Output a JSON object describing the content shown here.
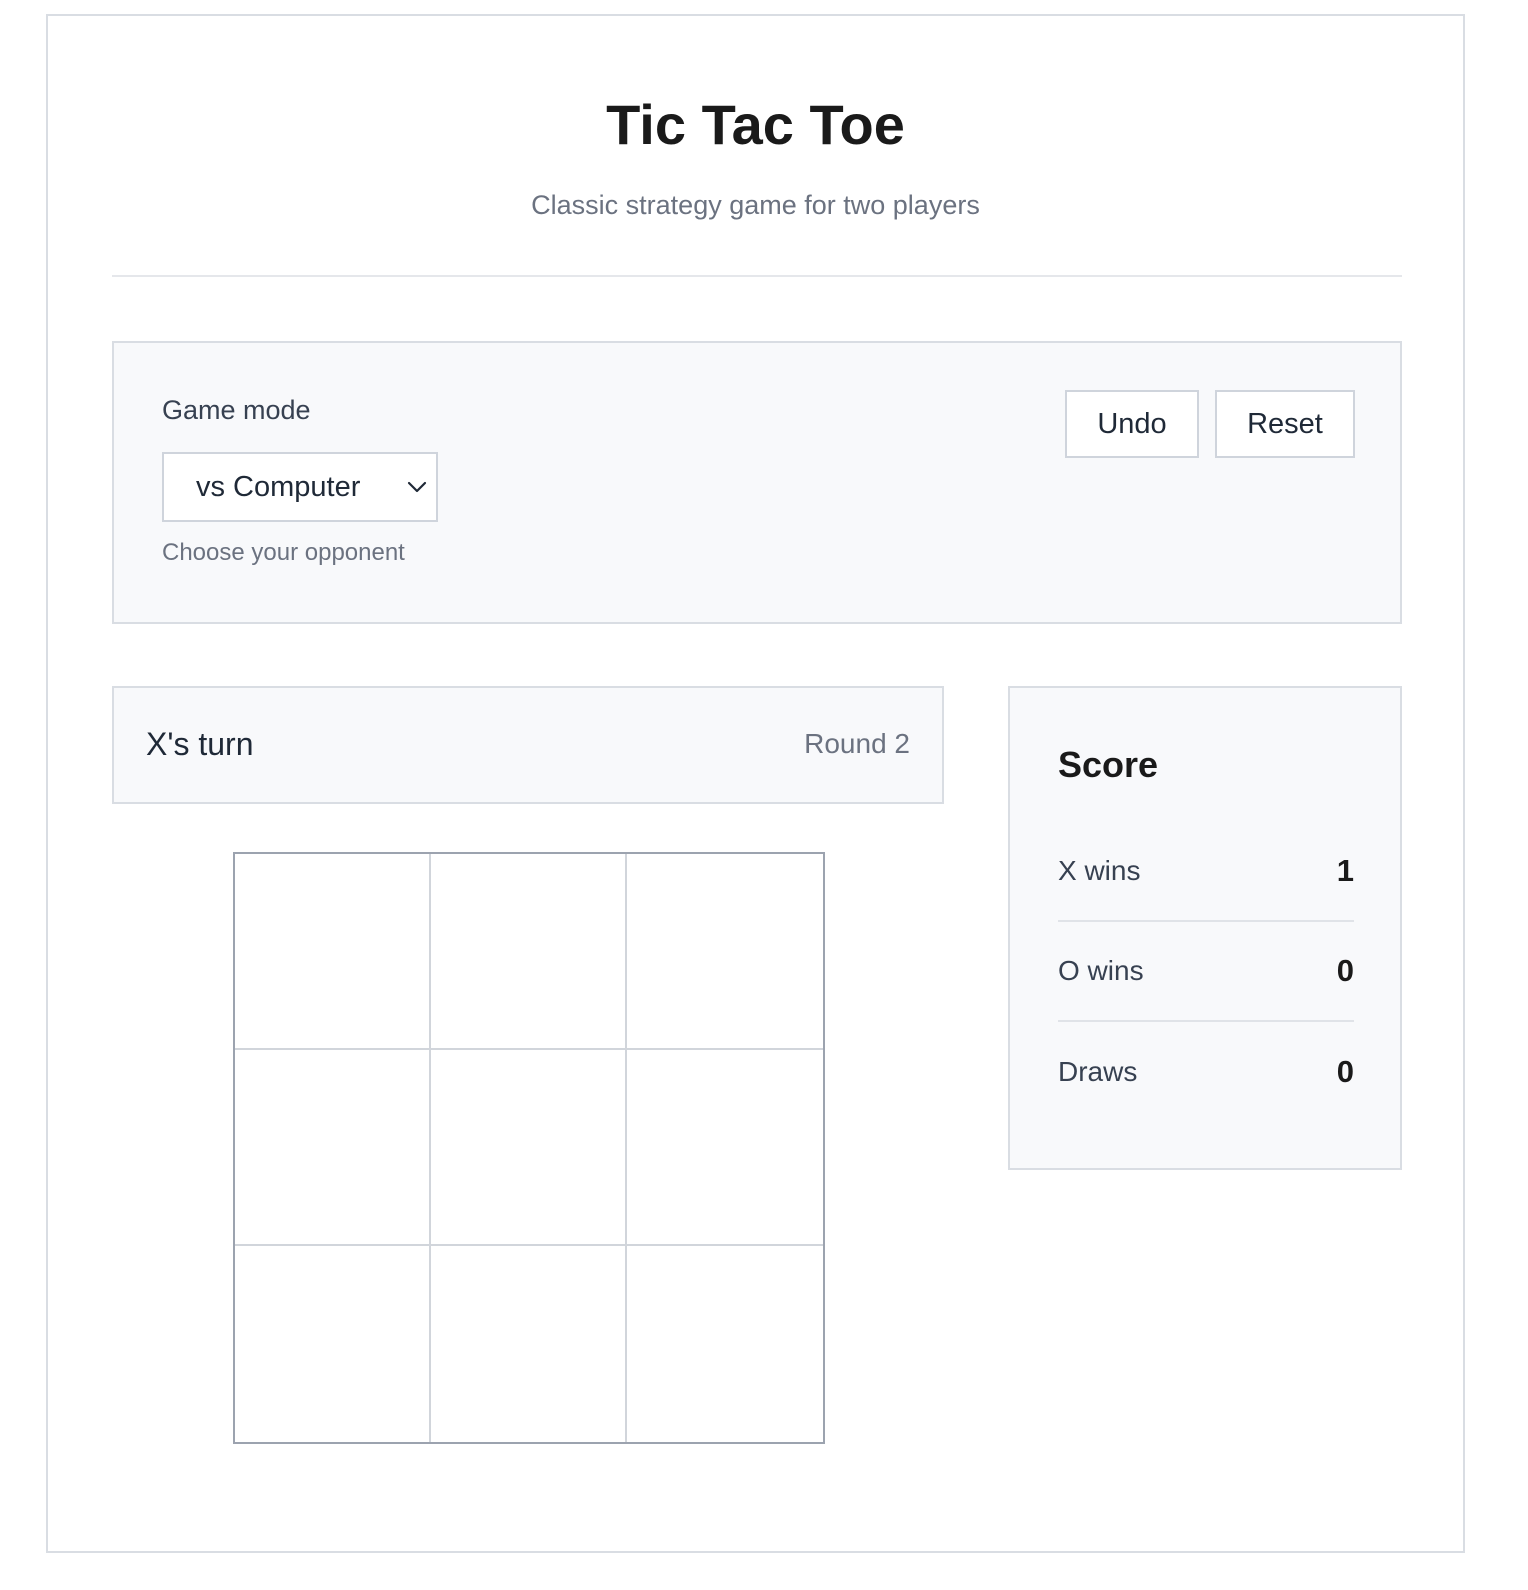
{
  "header": {
    "title": "Tic Tac Toe",
    "subtitle": "Classic strategy game for two players"
  },
  "controls": {
    "mode_label": "Game mode",
    "mode_selected": "vs Computer",
    "mode_help": "Choose your opponent",
    "undo_label": "Undo",
    "reset_label": "Reset"
  },
  "status": {
    "turn": "X's turn",
    "round": "Round 2"
  },
  "board": {
    "cells": [
      "",
      "",
      "",
      "",
      "",
      "",
      "",
      "",
      ""
    ]
  },
  "score": {
    "title": "Score",
    "x_wins_label": "X wins",
    "x_wins": "1",
    "o_wins_label": "O wins",
    "o_wins": "0",
    "draws_label": "Draws",
    "draws": "0"
  },
  "icons": {
    "select_chevron": "chevron-down-icon"
  },
  "colors": {
    "panel_bg": "#f8f9fb",
    "border": "#d9dde3",
    "muted_text": "#6b7280"
  }
}
